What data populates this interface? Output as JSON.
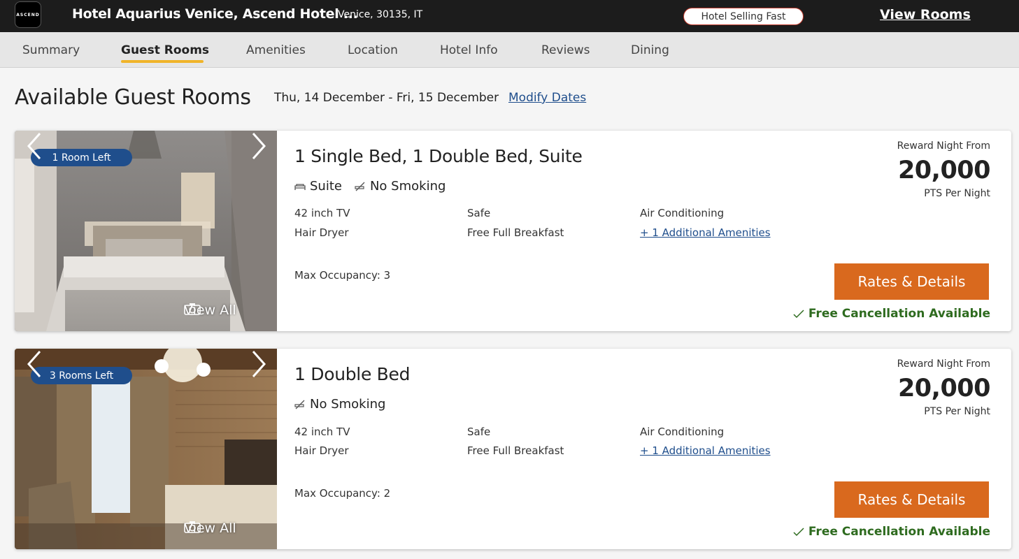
{
  "header": {
    "logo_text": "ASCEND",
    "hotel_name": "Hotel Aquarius Venice, Ascend Hotel ...",
    "location": "Venice, 30135, IT",
    "badge": "Hotel Selling Fast",
    "view_rooms": "View Rooms"
  },
  "tabs": [
    {
      "label": "Summary"
    },
    {
      "label": "Guest Rooms"
    },
    {
      "label": "Amenities"
    },
    {
      "label": "Location"
    },
    {
      "label": "Hotel Info"
    },
    {
      "label": "Reviews"
    },
    {
      "label": "Dining"
    }
  ],
  "active_tab": "Guest Rooms",
  "page": {
    "title": "Available Guest Rooms",
    "dates": "Thu, 14 December - Fri, 15 December",
    "modify_dates": "Modify Dates"
  },
  "rooms": [
    {
      "availability": "1 Room Left",
      "title": "1 Single Bed, 1 Double Bed, Suite",
      "tag_suite": "Suite",
      "tag_smoking": "No Smoking",
      "amenities": [
        "42 inch TV",
        "Safe",
        "Air Conditioning",
        "Hair Dryer",
        "Free Full Breakfast"
      ],
      "more_amenities": "+ 1 Additional Amenities",
      "occupancy": "Max Occupancy: 3",
      "reward_label": "Reward Night From",
      "points": "20,000",
      "points_unit": "PTS Per Night",
      "button": "Rates & Details",
      "cancellation": "Free Cancellation Available",
      "view_all": "View All"
    },
    {
      "availability": "3 Rooms Left",
      "title": "1 Double Bed",
      "tag_smoking": "No Smoking",
      "amenities": [
        "42 inch TV",
        "Safe",
        "Air Conditioning",
        "Hair Dryer",
        "Free Full Breakfast"
      ],
      "more_amenities": "+ 1 Additional Amenities",
      "occupancy": "Max Occupancy: 2",
      "reward_label": "Reward Night From",
      "points": "20,000",
      "points_unit": "PTS Per Night",
      "button": "Rates & Details",
      "cancellation": "Free Cancellation Available",
      "view_all": "View All"
    }
  ],
  "colors": {
    "topbar": "#1c1c1c",
    "accent_blue": "#1f4e8c",
    "button_orange": "#d9691e",
    "cancel_green": "#2e6b1f",
    "tab_underline": "#f0b429"
  }
}
